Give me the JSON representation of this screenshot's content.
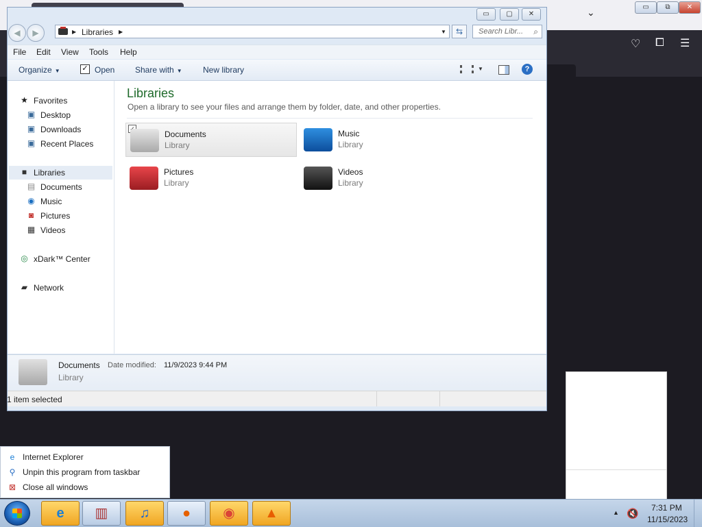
{
  "background_window": {
    "controls": {
      "minimize": "▭",
      "restore": "⧉",
      "close": "✕"
    }
  },
  "explorer": {
    "window_controls": {
      "minimize": "▭",
      "maximize": "▢",
      "close": "✕"
    },
    "address": {
      "path": "Libraries"
    },
    "search": {
      "placeholder": "Search Libr..."
    },
    "menu": [
      "File",
      "Edit",
      "View",
      "Tools",
      "Help"
    ],
    "toolbar": {
      "organize": "Organize",
      "open": "Open",
      "share_with": "Share with",
      "new_library": "New library",
      "help": "?"
    },
    "nav": {
      "favorites": "Favorites",
      "desktop": "Desktop",
      "downloads": "Downloads",
      "recent_places": "Recent Places",
      "libraries": "Libraries",
      "documents": "Documents",
      "music": "Music",
      "pictures": "Pictures",
      "videos": "Videos",
      "xdark": "xDark™ Center",
      "network": "Network"
    },
    "content": {
      "title": "Libraries",
      "subtitle": "Open a library to see your files and arrange them by folder, date, and other properties.",
      "libraries": [
        {
          "name": "Documents",
          "type": "Library"
        },
        {
          "name": "Music",
          "type": "Library"
        },
        {
          "name": "Pictures",
          "type": "Library"
        },
        {
          "name": "Videos",
          "type": "Library"
        }
      ]
    },
    "details": {
      "name": "Documents",
      "date_label": "Date modified:",
      "date_value": "11/9/2023 9:44 PM",
      "type": "Library"
    },
    "status": {
      "text": "1 item selected"
    }
  },
  "jumplist": {
    "items": [
      {
        "label": "Internet Explorer",
        "icon": "ie-icon"
      },
      {
        "label": "Unpin this program from taskbar",
        "icon": "unpin-icon"
      },
      {
        "label": "Close all windows",
        "icon": "close-windows-icon"
      }
    ]
  },
  "taskbar": {
    "apps": [
      "Internet Explorer",
      "Library",
      "iTunes",
      "Firefox",
      "Chrome",
      "VLC"
    ],
    "clock": {
      "time": "7:31 PM",
      "date": "11/15/2023"
    }
  },
  "colors": {
    "title_green": "#1e6a2a",
    "taskbar": "#b9cce4",
    "active_app": "#f0a623"
  }
}
